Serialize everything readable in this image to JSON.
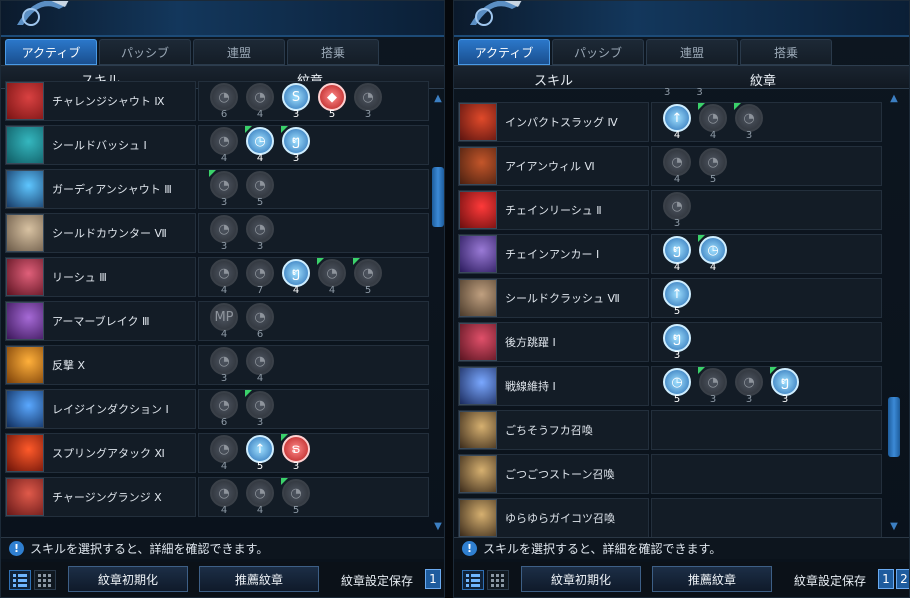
{
  "colors": {
    "accent": "#2b77c9",
    "glyph_active": "#3ea0ff",
    "glyph_red": "#d22a2a",
    "new_flag": "#3bd16a"
  },
  "left": {
    "tabs": [
      {
        "label": "アクティブ",
        "active": true
      },
      {
        "label": "パッシブ"
      },
      {
        "label": "連盟"
      },
      {
        "label": "搭乗"
      }
    ],
    "header": {
      "skill": "スキル",
      "glyph": "紋章"
    },
    "rows": [
      {
        "name": "チャレンジシャウト Ⅸ",
        "glyphs": [
          {
            "n": "6",
            "s": "off"
          },
          {
            "n": "4",
            "s": "off"
          },
          {
            "n": "3",
            "s": "on",
            "i": "S"
          },
          {
            "n": "5",
            "s": "red",
            "i": "◆"
          },
          {
            "n": "3",
            "s": "off"
          }
        ]
      },
      {
        "name": "シールドバッシュ Ⅰ",
        "glyphs": [
          {
            "n": "4",
            "s": "off"
          },
          {
            "n": "4",
            "s": "on",
            "i": "◷",
            "f": true
          },
          {
            "n": "3",
            "s": "on",
            "i": "ໆ",
            "f": true
          }
        ]
      },
      {
        "name": "ガーディアンシャウト Ⅲ",
        "glyphs": [
          {
            "n": "3",
            "s": "off",
            "f": true
          },
          {
            "n": "5",
            "s": "off"
          }
        ]
      },
      {
        "name": "シールドカウンター Ⅶ",
        "glyphs": [
          {
            "n": "3",
            "s": "off"
          },
          {
            "n": "3",
            "s": "off"
          }
        ]
      },
      {
        "name": "リーシュ Ⅲ",
        "glyphs": [
          {
            "n": "4",
            "s": "off"
          },
          {
            "n": "7",
            "s": "off"
          },
          {
            "n": "4",
            "s": "on",
            "i": "ໆ"
          },
          {
            "n": "4",
            "s": "off",
            "f": true
          },
          {
            "n": "5",
            "s": "off",
            "f": true
          }
        ]
      },
      {
        "name": "アーマーブレイク Ⅲ",
        "glyphs": [
          {
            "n": "4",
            "s": "off",
            "i": "MP"
          },
          {
            "n": "6",
            "s": "off"
          }
        ]
      },
      {
        "name": "反撃 Ⅹ",
        "glyphs": [
          {
            "n": "3",
            "s": "off"
          },
          {
            "n": "4",
            "s": "off"
          }
        ]
      },
      {
        "name": "レイジインダクション Ⅰ",
        "glyphs": [
          {
            "n": "6",
            "s": "off"
          },
          {
            "n": "3",
            "s": "off",
            "f": true
          }
        ]
      },
      {
        "name": "スプリングアタック Ⅺ",
        "glyphs": [
          {
            "n": "4",
            "s": "off"
          },
          {
            "n": "5",
            "s": "on",
            "i": "↑"
          },
          {
            "n": "3",
            "s": "red",
            "i": "ຣ",
            "f": true
          }
        ]
      },
      {
        "name": "チャージングランジ Ⅹ",
        "glyphs": [
          {
            "n": "4",
            "s": "off"
          },
          {
            "n": "4",
            "s": "off"
          },
          {
            "n": "5",
            "s": "off",
            "f": true
          }
        ]
      }
    ],
    "info": "スキルを選択すると、詳細を確認できます。",
    "buttons": {
      "reset": "紋章初期化",
      "recommend": "推薦紋章",
      "save": "紋章設定保存",
      "slot1": "1"
    }
  },
  "right": {
    "tabs": [
      {
        "label": "アクティブ",
        "active": true
      },
      {
        "label": "パッシブ"
      },
      {
        "label": "連盟"
      },
      {
        "label": "搭乗"
      }
    ],
    "header": {
      "skill": "スキル",
      "glyph": "紋章"
    },
    "top_partial": [
      "3",
      "3"
    ],
    "rows": [
      {
        "name": "インパクトスラッグ Ⅳ",
        "glyphs": [
          {
            "n": "4",
            "s": "on",
            "i": "↑"
          },
          {
            "n": "4",
            "s": "off",
            "f": true
          },
          {
            "n": "3",
            "s": "off",
            "f": true
          }
        ]
      },
      {
        "name": "アイアンウィル Ⅵ",
        "glyphs": [
          {
            "n": "4",
            "s": "off"
          },
          {
            "n": "5",
            "s": "off"
          }
        ]
      },
      {
        "name": "チェインリーシュ Ⅱ",
        "glyphs": [
          {
            "n": "3",
            "s": "off"
          }
        ]
      },
      {
        "name": "チェインアンカー Ⅰ",
        "glyphs": [
          {
            "n": "4",
            "s": "on",
            "i": "ໆ"
          },
          {
            "n": "4",
            "s": "on",
            "i": "◷",
            "f": true
          }
        ]
      },
      {
        "name": "シールドクラッシュ Ⅶ",
        "glyphs": [
          {
            "n": "5",
            "s": "on",
            "i": "↑"
          }
        ]
      },
      {
        "name": "後方跳躍 Ⅰ",
        "glyphs": [
          {
            "n": "3",
            "s": "on",
            "i": "ໆ"
          }
        ]
      },
      {
        "name": "戦線維持 Ⅰ",
        "glyphs": [
          {
            "n": "5",
            "s": "on",
            "i": "◷"
          },
          {
            "n": "3",
            "s": "off",
            "f": true
          },
          {
            "n": "3",
            "s": "off"
          },
          {
            "n": "3",
            "s": "on",
            "i": "ໆ",
            "f": true
          }
        ]
      },
      {
        "name": "ごちそうフカ召喚",
        "glyphs": []
      },
      {
        "name": "ごつごつストーン召喚",
        "glyphs": []
      },
      {
        "name": "ゆらゆらガイコツ召喚",
        "glyphs": []
      }
    ],
    "info": "スキルを選択すると、詳細を確認できます。",
    "buttons": {
      "reset": "紋章初期化",
      "recommend": "推薦紋章",
      "save": "紋章設定保存",
      "slot1": "1",
      "slot2": "2"
    }
  }
}
